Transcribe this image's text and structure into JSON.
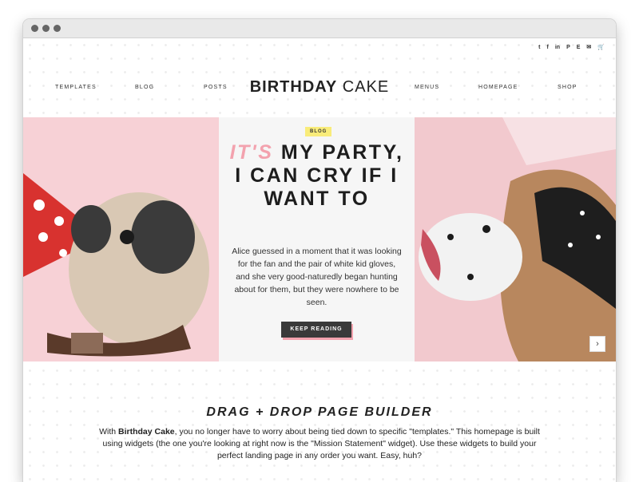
{
  "social_icons": [
    "t",
    "f",
    "in",
    "P",
    "E",
    "✉",
    "🛒"
  ],
  "social_names": [
    "twitter-icon",
    "facebook-icon",
    "linkedin-icon",
    "pinterest-icon",
    "etsy-icon",
    "mail-icon",
    "cart-icon"
  ],
  "nav": {
    "templates": "TEMPLATES",
    "blog": "BLOG",
    "posts": "POSTS",
    "menus": "MENUS",
    "homepage": "HOMEPAGE",
    "shop": "SHOP"
  },
  "logo": {
    "bold": "BIRTHDAY",
    "light": "CAKE"
  },
  "hero": {
    "tag": "BLOG",
    "title_accent": "IT'S",
    "title_rest": "MY PARTY, I CAN CRY IF I WANT TO",
    "excerpt": "Alice guessed in a moment that it was looking for the fan and the pair of white kid gloves, and she very good-naturedly began hunting about for them, but they were nowhere to be seen.",
    "button": "KEEP READING",
    "next_arrow": "›"
  },
  "mission": {
    "title": "DRAG + DROP PAGE BUILDER",
    "text_before": "With ",
    "text_bold": "Birthday Cake",
    "text_after": ", you no longer have to worry about being tied down to specific \"templates.\" This homepage is built using widgets (the one you're looking at right now is the \"Mission Statement\" widget). Use these widgets to build your perfect landing page in any order you want. Easy, huh?"
  },
  "colors": {
    "accent_pink": "#f3a2ae",
    "tag_yellow": "#f9ec7a",
    "button_dark": "#3a3a3a"
  }
}
